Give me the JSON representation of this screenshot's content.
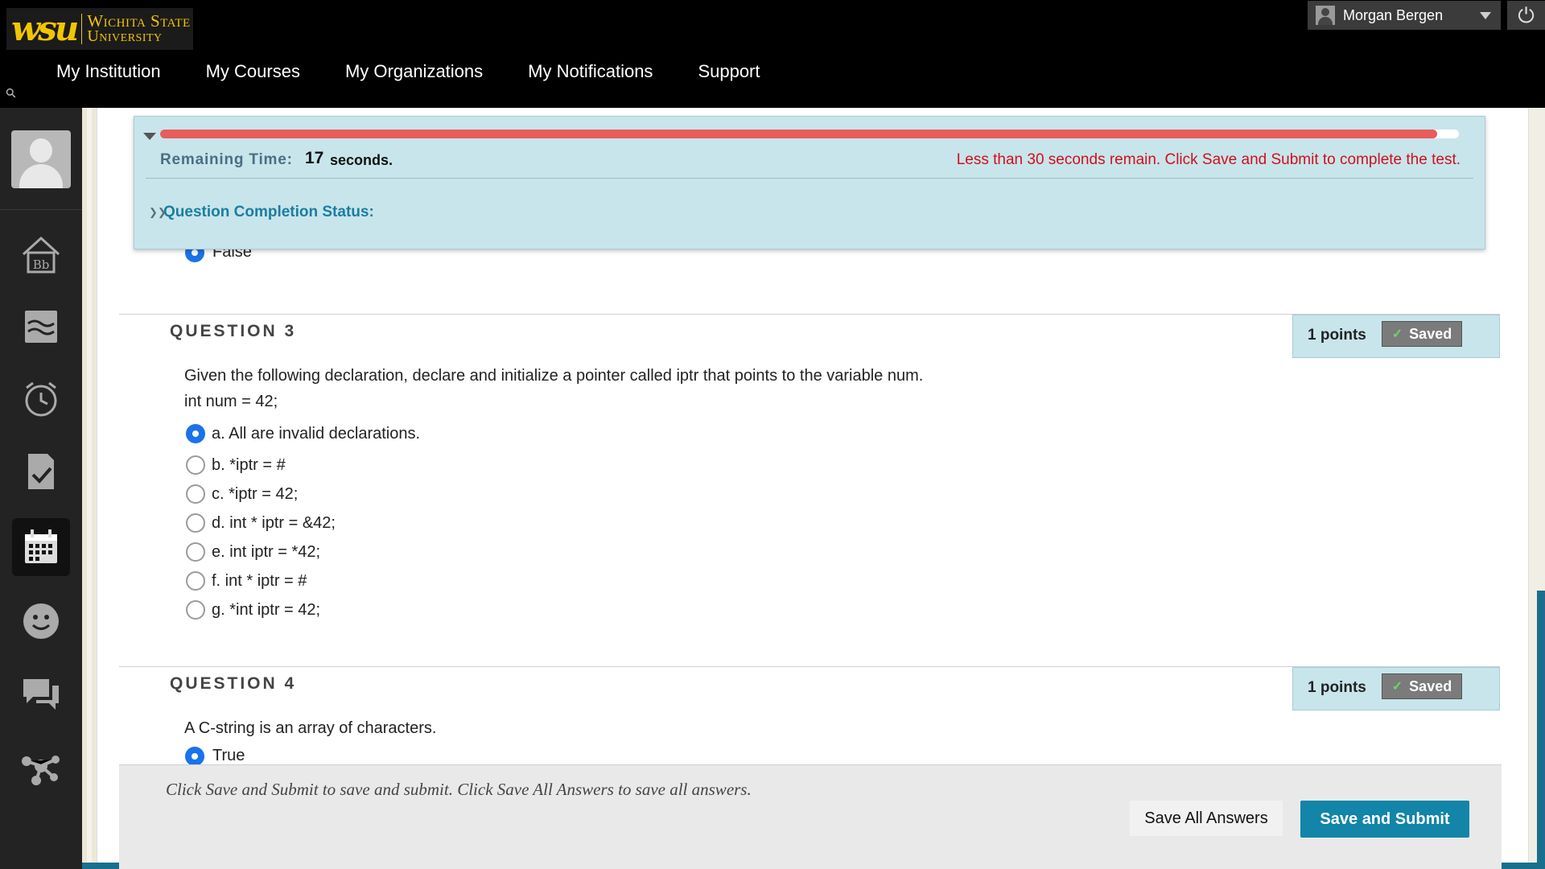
{
  "logo": {
    "mark": "wsu",
    "line1": "Wichita State",
    "line2": "University"
  },
  "user": {
    "name": "Morgan Bergen"
  },
  "nav": [
    "My Institution",
    "My Courses",
    "My Organizations",
    "My Notifications",
    "Support"
  ],
  "sidebar_icons": [
    "home-icon",
    "course-stream-icon",
    "clock-icon",
    "grades-icon",
    "calendar-icon",
    "smiley-icon",
    "messages-icon",
    "tools-icon"
  ],
  "timer": {
    "remaining_label": "Remaining Time:",
    "remaining_value": "17",
    "remaining_unit": "seconds.",
    "progress_fraction": 0.983,
    "warning": "Less than 30 seconds remain. Click Save and Submit to complete the test.",
    "completion_status_label": "Question Completion Status:"
  },
  "previous_question": {
    "selected_label": "False"
  },
  "question3": {
    "title": "QUESTION 3",
    "points": "1 points",
    "saved": "Saved",
    "text_line1": "Given the following declaration, declare and initialize a pointer called iptr that points to the variable num.",
    "text_line2": "int num = 42;",
    "options": [
      {
        "label": "a. All are invalid declarations.",
        "checked": true
      },
      {
        "label": "b. *iptr = #",
        "checked": false
      },
      {
        "label": "c. *iptr = 42;",
        "checked": false
      },
      {
        "label": "d. int * iptr = &42;",
        "checked": false
      },
      {
        "label": "e. int iptr = *42;",
        "checked": false
      },
      {
        "label": "f.  int * iptr = #",
        "checked": false
      },
      {
        "label": "g. *int iptr = 42;",
        "checked": false
      }
    ]
  },
  "question4": {
    "title": "QUESTION 4",
    "points": "1 points",
    "saved": "Saved",
    "text": "A C-string is an array of characters.",
    "selected_label": "True"
  },
  "footer": {
    "note": "Click Save and Submit to save and submit. Click Save All Answers to save all answers.",
    "save_all": "Save All Answers",
    "save_submit": "Save and Submit"
  },
  "colors": {
    "accent": "#1285a8",
    "warning": "#d10f1c",
    "brand_gold": "#f2c500",
    "timer_bg": "#c8e5ec"
  }
}
